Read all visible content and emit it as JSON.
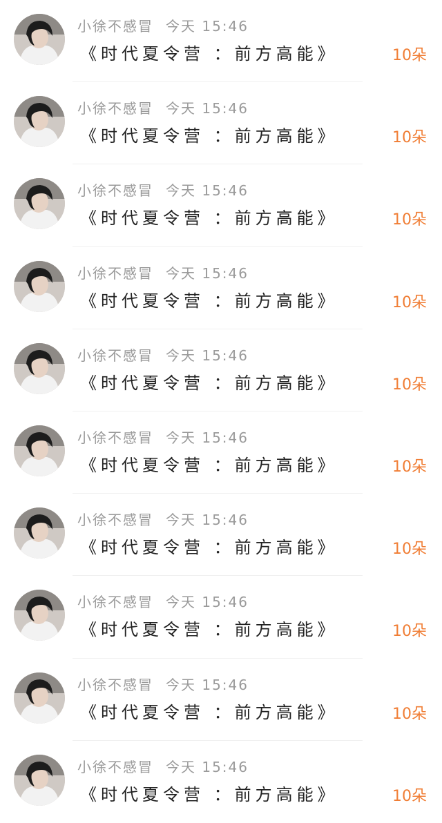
{
  "list": {
    "items": [
      {
        "username": "小徐不感冒",
        "time": "今天 15:46",
        "content": "《时代夏令营 ：前方高能》",
        "gift": "10朵"
      },
      {
        "username": "小徐不感冒",
        "time": "今天 15:46",
        "content": "《时代夏令营 ：前方高能》",
        "gift": "10朵"
      },
      {
        "username": "小徐不感冒",
        "time": "今天 15:46",
        "content": "《时代夏令营 ：前方高能》",
        "gift": "10朵"
      },
      {
        "username": "小徐不感冒",
        "time": "今天 15:46",
        "content": "《时代夏令营 ：前方高能》",
        "gift": "10朵"
      },
      {
        "username": "小徐不感冒",
        "time": "今天 15:46",
        "content": "《时代夏令营 ：前方高能》",
        "gift": "10朵"
      },
      {
        "username": "小徐不感冒",
        "time": "今天 15:46",
        "content": "《时代夏令营 ：前方高能》",
        "gift": "10朵"
      },
      {
        "username": "小徐不感冒",
        "time": "今天 15:46",
        "content": "《时代夏令营 ：前方高能》",
        "gift": "10朵"
      },
      {
        "username": "小徐不感冒",
        "time": "今天 15:46",
        "content": "《时代夏令营 ：前方高能》",
        "gift": "10朵"
      },
      {
        "username": "小徐不感冒",
        "time": "今天 15:46",
        "content": "《时代夏令营 ：前方高能》",
        "gift": "10朵"
      },
      {
        "username": "小徐不感冒",
        "time": "今天 15:46",
        "content": "《时代夏令营 ：前方高能》",
        "gift": "10朵"
      }
    ]
  },
  "colors": {
    "username": "#9a9a9a",
    "content": "#222222",
    "gift": "#f07d34",
    "divider": "#f0f0f0"
  },
  "icons": {
    "avatar": "user-avatar-photo"
  }
}
